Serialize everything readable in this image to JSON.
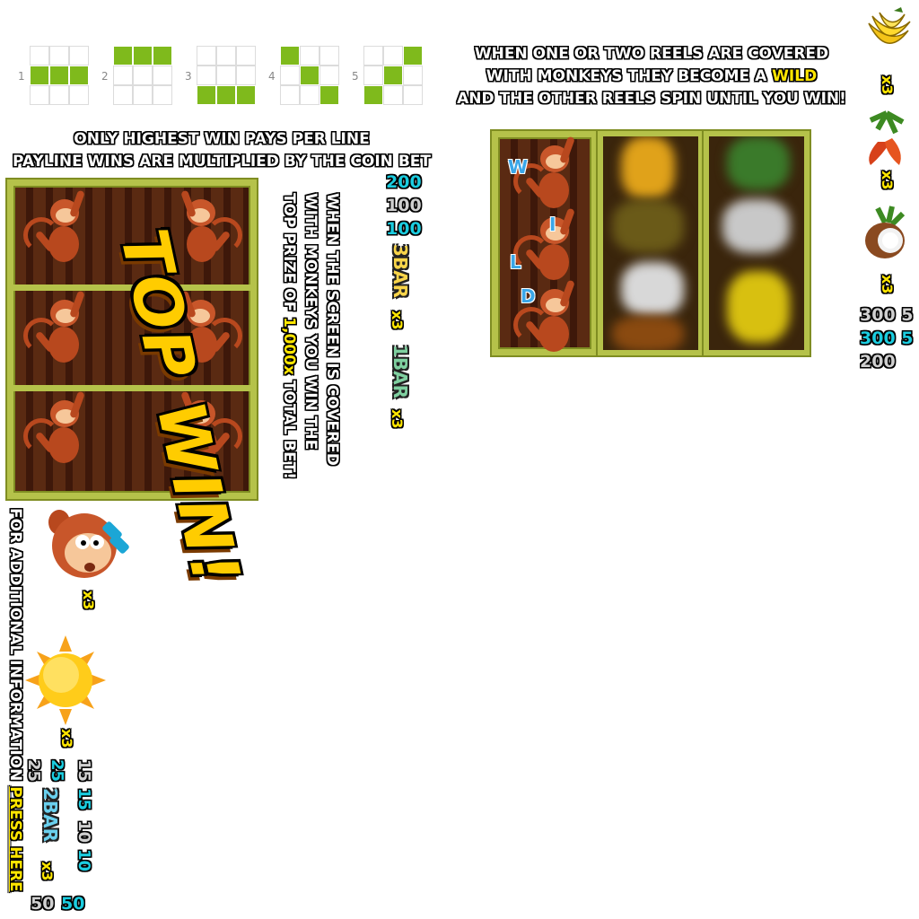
{
  "paylines": [
    {
      "number": "1",
      "cells": [
        0,
        0,
        0,
        1,
        1,
        1,
        0,
        0,
        0
      ]
    },
    {
      "number": "2",
      "cells": [
        1,
        1,
        1,
        0,
        0,
        0,
        0,
        0,
        0
      ]
    },
    {
      "number": "3",
      "cells": [
        0,
        0,
        0,
        0,
        0,
        0,
        1,
        1,
        1
      ]
    },
    {
      "number": "4",
      "cells": [
        1,
        0,
        0,
        0,
        1,
        0,
        0,
        0,
        1
      ]
    },
    {
      "number": "5",
      "cells": [
        0,
        0,
        1,
        0,
        1,
        0,
        1,
        0,
        0
      ]
    }
  ],
  "wild_text": {
    "line1": "WHEN ONE OR TWO REELS ARE COVERED",
    "line2_before": "WITH MONKEYS THEY BECOME A ",
    "line2_highlight": "WILD",
    "line3": "AND THE OTHER REELS SPIN UNTIL YOU WIN!"
  },
  "pays_text": {
    "line1": "ONLY HIGHEST WIN PAYS PER LINE",
    "line2": "PAYLINE WINS ARE MULTIPLIED BY THE COIN BET"
  },
  "topwin_banner": "TOP WIN!",
  "cover_text": {
    "line1": "WHEN THE SCREEN IS COVERED",
    "line2": "WITH MONKEYS YOU WIN THE",
    "line3_before": "TOP PRIZE OF ",
    "line3_highlight": "1,000x",
    "line3_after": " TOTAL BET!"
  },
  "wild_letters": [
    "W",
    "I",
    "L",
    "D"
  ],
  "pay_values_left": {
    "v1": "200",
    "v2": "100",
    "v3": "100"
  },
  "bar_symbols": {
    "three_bar": "3BAR",
    "one_bar": "1BAR",
    "two_bar": "2BAR"
  },
  "multiplier": "x3",
  "pay_values_right": {
    "row1a": "300",
    "row1b": "5",
    "row2a": "300",
    "row2b": "5",
    "row3": "200"
  },
  "pay_values_bottom": {
    "c1a": "25",
    "c1b": "25",
    "c2a": "15",
    "c2b": "15",
    "c3a": "10",
    "c3b": "10",
    "c4a": "50",
    "c4b": "50"
  },
  "info_text": {
    "before": "FOR ADDITIONAL INFORMATION ",
    "link": "PRESS HERE"
  },
  "colors": {
    "green": "#7fba1c",
    "yellow": "#ffe600",
    "cyan": "#1bcde0",
    "bamboo": "#b5c24a"
  },
  "icons": [
    "banana-icon",
    "chili-icon",
    "coconut-icon",
    "monkey-face-icon",
    "sun-icon"
  ]
}
